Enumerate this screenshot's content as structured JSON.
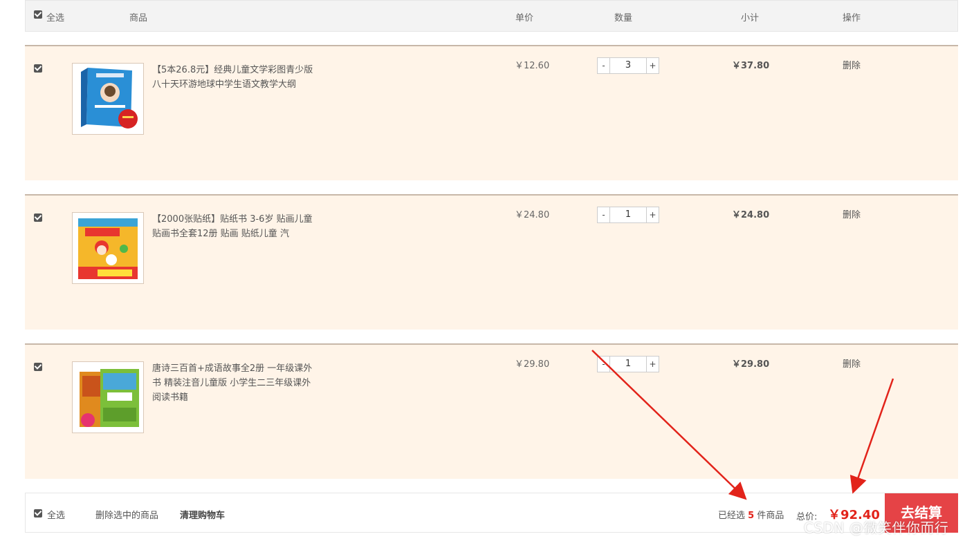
{
  "header": {
    "select_all": "全选",
    "col_product": "商品",
    "col_unit_price": "单价",
    "col_quantity": "数量",
    "col_subtotal": "小计",
    "col_action": "操作"
  },
  "items": [
    {
      "title": "【5本26.8元】经典儿童文学彩图青少版八十天环游地球中学生语文教学大纲",
      "price": "￥12.60",
      "qty": "3",
      "subtotal": "￥37.80",
      "delete": "删除",
      "checked": true
    },
    {
      "title": "【2000张贴纸】贴纸书 3-6岁 贴画儿童 贴画书全套12册 贴画 贴纸儿童 汽",
      "price": "￥24.80",
      "qty": "1",
      "subtotal": "￥24.80",
      "delete": "删除",
      "checked": true
    },
    {
      "title": "唐诗三百首+成语故事全2册 一年级课外书 精装注音儿童版 小学生二三年级课外阅读书籍",
      "price": "￥29.80",
      "qty": "1",
      "subtotal": "￥29.80",
      "delete": "删除",
      "checked": true
    }
  ],
  "qty_controls": {
    "minus": "-",
    "plus": "+"
  },
  "footer": {
    "select_all": "全选",
    "delete_selected": "删除选中的商品",
    "clear_cart": "清理购物车",
    "selected_prefix": "已经选",
    "selected_count": "5",
    "selected_suffix": " 件商品",
    "total_label": "总价:",
    "total": "￥92.40",
    "checkout": "去结算"
  },
  "watermark": "CSDN @微笑伴你而行",
  "colors": {
    "accent_red": "#e2231a",
    "checkout_bg": "#e54346",
    "item_bg": "#fff4e8"
  }
}
